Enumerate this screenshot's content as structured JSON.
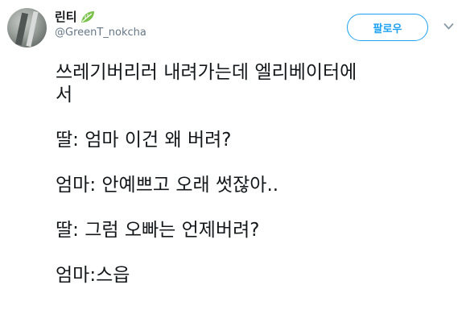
{
  "user": {
    "display_name": "린티",
    "handle": "@GreenT_nokcha"
  },
  "follow_button_label": "팔로우",
  "tweet": {
    "lines": [
      "쓰레기버리러 내려가는데 엘리베이터에",
      "서",
      "딸: 엄마 이건 왜 버려?",
      "엄마: 안예쁘고 오래 썻잖아..",
      "딸: 그럼 오빠는 언제버려?",
      "엄마:스읍"
    ]
  },
  "icons": {
    "name_badge": "leaf-icon",
    "menu": "chevron-down-icon"
  },
  "colors": {
    "accent": "#1da1f2",
    "text": "#14171a",
    "muted": "#657786",
    "leaf": "#7bc24a"
  }
}
